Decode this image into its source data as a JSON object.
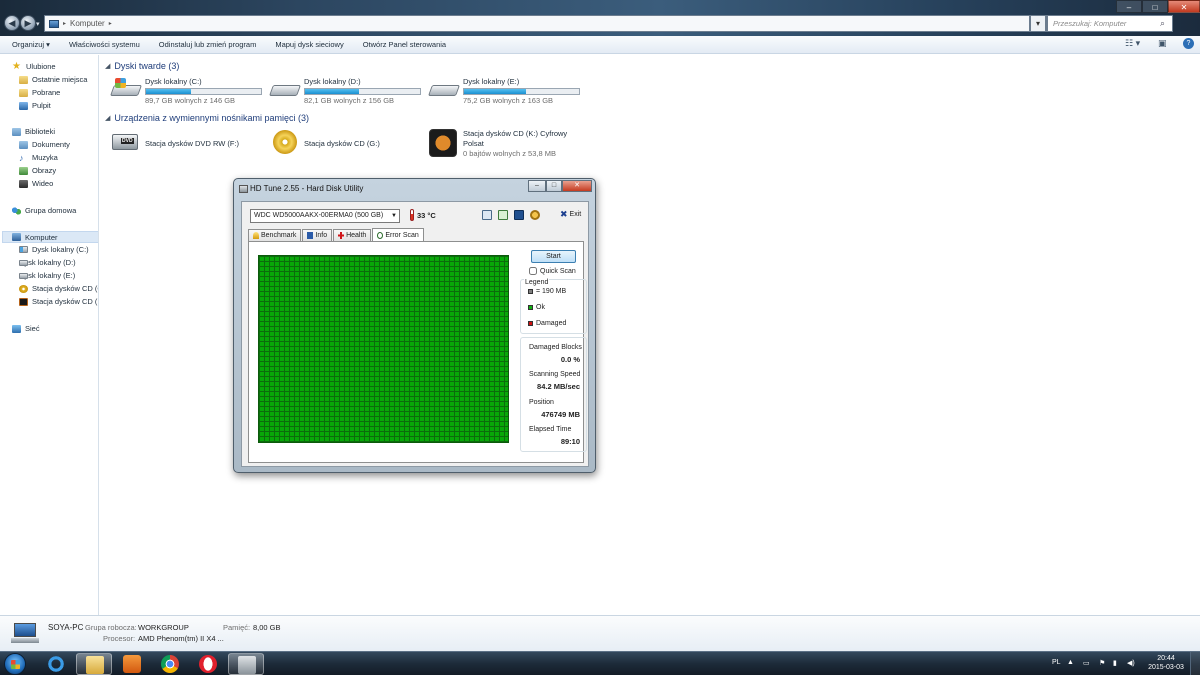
{
  "explorer": {
    "breadcrumb": "Komputer",
    "search_placeholder": "Przeszukaj: Komputer",
    "toolbar": [
      "Organizuj ▾",
      "Właściwości systemu",
      "Odinstaluj lub zmień program",
      "Mapuj dysk sieciowy",
      "Otwórz Panel sterowania"
    ],
    "nav": {
      "favorites": "Ulubione",
      "fav_items": [
        "Ostatnie miejsca",
        "Pobrane",
        "Pulpit"
      ],
      "libraries": "Biblioteki",
      "lib_items": [
        "Dokumenty",
        "Muzyka",
        "Obrazy",
        "Wideo"
      ],
      "homegroup": "Grupa domowa",
      "computer": "Komputer",
      "comp_items": [
        "Dysk lokalny (C:)",
        "Dysk lokalny (D:)",
        "Dysk lokalny (E:)",
        "Stacja dysków CD (G",
        "Stacja dysków CD (K"
      ],
      "network": "Sieć"
    },
    "sections": {
      "hdd": "Dyski twarde (3)",
      "removable": "Urządzenia z wymiennymi nośnikami pamięci (3)"
    },
    "drives": [
      {
        "name": "Dysk lokalny (C:)",
        "free": "89,7 GB wolnych z 146 GB",
        "used_fraction": 0.39
      },
      {
        "name": "Dysk lokalny (D:)",
        "free": "82,1 GB wolnych z 156 GB",
        "used_fraction": 0.47
      },
      {
        "name": "Dysk lokalny (E:)",
        "free": "75,2 GB wolnych z 163 GB",
        "used_fraction": 0.54
      }
    ],
    "removable": [
      {
        "name": "Stacja dysków DVD RW (F:)",
        "badge": "DVD"
      },
      {
        "name": "Stacja dysków CD (G:)"
      },
      {
        "name": "Stacja dysków CD (K:) Cyfrowy Polsat",
        "free": "0 bajtów wolnych z 53,8 MB"
      }
    ],
    "details": {
      "pc_name": "SOYA-PC",
      "workgroup_label": "Grupa robocza:",
      "workgroup": "WORKGROUP",
      "memory_label": "Pamięć:",
      "memory": "8,00 GB",
      "cpu_label": "Procesor:",
      "cpu": "AMD Phenom(tm) II X4 ..."
    }
  },
  "hdtune": {
    "title": "HD Tune 2.55 - Hard Disk Utility",
    "drive_select": "WDC WD5000AAKX-00ERMA0 (500 GB)",
    "temperature": "33 °C",
    "exit_label": "Exit",
    "tabs": [
      "Benchmark",
      "Info",
      "Health",
      "Error Scan"
    ],
    "active_tab": "Error Scan",
    "start_label": "Start",
    "quick_scan_label": "Quick Scan",
    "legend_title": "Legend",
    "legend": [
      {
        "label": "= 190 MB",
        "color": "#808080"
      },
      {
        "label": "Ok",
        "color": "#10b010"
      },
      {
        "label": "Damaged",
        "color": "#d01010"
      }
    ],
    "stats": [
      {
        "label": "Damaged Blocks",
        "value": "0.0 %"
      },
      {
        "label": "Scanning Speed",
        "value": "84.2 MB/sec"
      },
      {
        "label": "Position",
        "value": "476749 MB"
      },
      {
        "label": "Elapsed Time",
        "value": "89:10"
      }
    ],
    "scan_ok_color": "#08a808"
  },
  "taskbar": {
    "language": "PL",
    "time": "20:44",
    "date": "2015-03-03"
  }
}
